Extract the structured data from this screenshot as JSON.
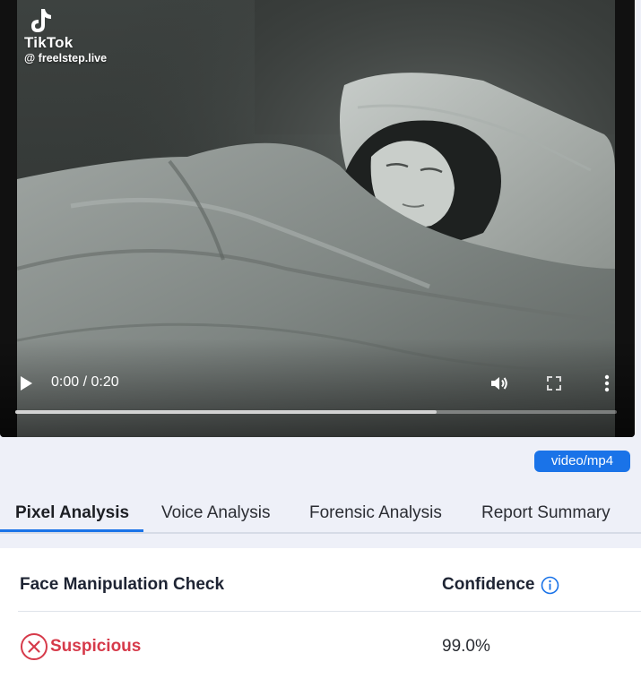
{
  "video": {
    "watermark_brand": "TikTok",
    "watermark_handle": "@ freelstep.live",
    "time": "0:00 / 0:20",
    "progress": 0.7
  },
  "mime_badge": "video/mp4",
  "tabs": [
    {
      "label": "Pixel Analysis",
      "active": true
    },
    {
      "label": "Voice Analysis",
      "active": false
    },
    {
      "label": "Forensic Analysis",
      "active": false
    },
    {
      "label": "Report Summary",
      "active": false
    }
  ],
  "table": {
    "col_check": "Face Manipulation Check",
    "col_confidence": "Confidence",
    "rows": [
      {
        "status": "Suspicious",
        "confidence": "99.0%"
      }
    ]
  },
  "colors": {
    "accent": "#1a73e8",
    "suspicious": "#d63a4a",
    "page_bg": "#eef0f8"
  },
  "icons": [
    "tiktok-logo-icon",
    "play-icon",
    "volume-icon",
    "fullscreen-icon",
    "more-vert-icon",
    "info-icon",
    "x-circle-icon"
  ]
}
